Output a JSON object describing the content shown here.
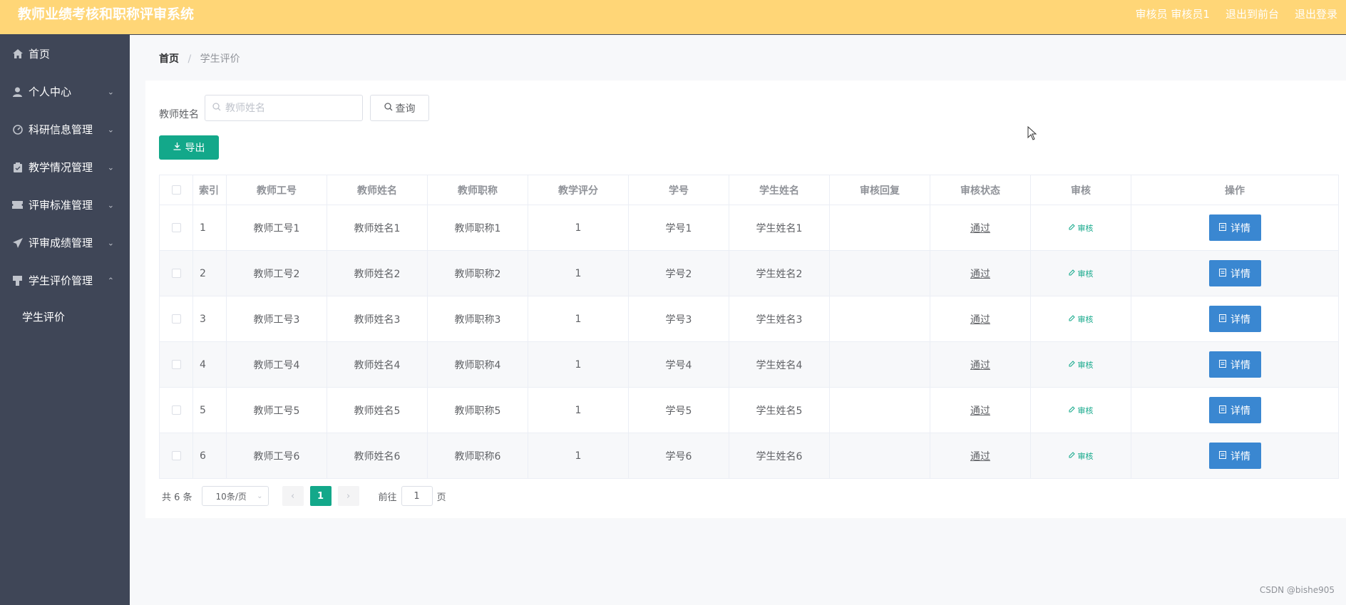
{
  "header": {
    "title": "教师业绩考核和职称评审系统",
    "user": "审核员 审核员1",
    "back_to_front": "退出到前台",
    "logout": "退出登录"
  },
  "sidebar": {
    "items": [
      {
        "label": "首页",
        "icon": "home-icon"
      },
      {
        "label": "个人中心",
        "icon": "user-icon"
      },
      {
        "label": "科研信息管理",
        "icon": "gauge-icon"
      },
      {
        "label": "教学情况管理",
        "icon": "clipboard-icon"
      },
      {
        "label": "评审标准管理",
        "icon": "ticket-icon"
      },
      {
        "label": "评审成绩管理",
        "icon": "send-icon"
      },
      {
        "label": "学生评价管理",
        "icon": "stamp-icon"
      }
    ],
    "sub_item": "学生评价"
  },
  "breadcrumb": {
    "home": "首页",
    "sep": "/",
    "current": "学生评价"
  },
  "search": {
    "label": "教师姓名",
    "placeholder": "教师姓名",
    "button": "查询"
  },
  "export_button": "导出",
  "table": {
    "columns": [
      "索引",
      "教师工号",
      "教师姓名",
      "教师职称",
      "教学评分",
      "学号",
      "学生姓名",
      "审核回复",
      "审核状态",
      "审核",
      "操作"
    ],
    "rows": [
      {
        "idx": "1",
        "tno": "教师工号1",
        "tname": "教师姓名1",
        "title": "教师职称1",
        "score": "1",
        "sno": "学号1",
        "sname": "学生姓名1",
        "reply": "",
        "status": "通过",
        "audit": "审核",
        "action": "详情"
      },
      {
        "idx": "2",
        "tno": "教师工号2",
        "tname": "教师姓名2",
        "title": "教师职称2",
        "score": "1",
        "sno": "学号2",
        "sname": "学生姓名2",
        "reply": "",
        "status": "通过",
        "audit": "审核",
        "action": "详情"
      },
      {
        "idx": "3",
        "tno": "教师工号3",
        "tname": "教师姓名3",
        "title": "教师职称3",
        "score": "1",
        "sno": "学号3",
        "sname": "学生姓名3",
        "reply": "",
        "status": "通过",
        "audit": "审核",
        "action": "详情"
      },
      {
        "idx": "4",
        "tno": "教师工号4",
        "tname": "教师姓名4",
        "title": "教师职称4",
        "score": "1",
        "sno": "学号4",
        "sname": "学生姓名4",
        "reply": "",
        "status": "通过",
        "audit": "审核",
        "action": "详情"
      },
      {
        "idx": "5",
        "tno": "教师工号5",
        "tname": "教师姓名5",
        "title": "教师职称5",
        "score": "1",
        "sno": "学号5",
        "sname": "学生姓名5",
        "reply": "",
        "status": "通过",
        "audit": "审核",
        "action": "详情"
      },
      {
        "idx": "6",
        "tno": "教师工号6",
        "tname": "教师姓名6",
        "title": "教师职称6",
        "score": "1",
        "sno": "学号6",
        "sname": "学生姓名6",
        "reply": "",
        "status": "通过",
        "audit": "审核",
        "action": "详情"
      }
    ]
  },
  "pagination": {
    "total": "共 6 条",
    "page_size": "10条/页",
    "current_page": "1",
    "jump_prefix": "前往",
    "jump_value": "1",
    "jump_suffix": "页"
  },
  "watermark": "CSDN @bishe905",
  "colors": {
    "header": "#ffd677",
    "sidebar": "#3f4657",
    "accent": "#13a88a",
    "detail": "#3a87d1"
  }
}
